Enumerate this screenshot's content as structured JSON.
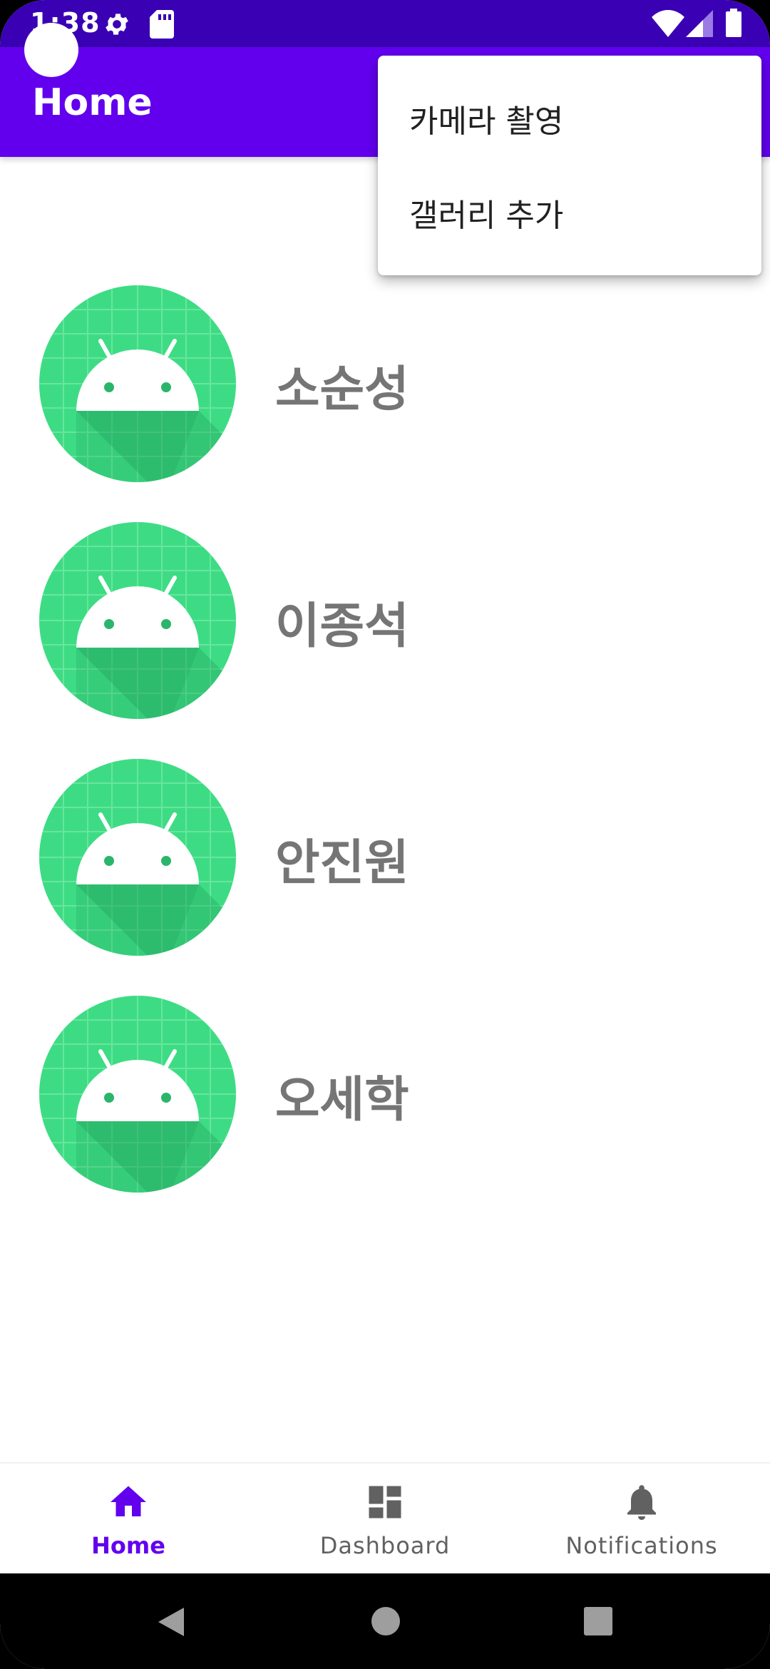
{
  "status_bar": {
    "time": "1:38",
    "icons": [
      "gear-icon",
      "sd-card-icon",
      "wifi-icon",
      "signal-icon",
      "battery-icon"
    ]
  },
  "app_bar": {
    "title": "Home",
    "color": "#6200ee"
  },
  "menu": {
    "items": [
      {
        "label": "카메라 촬영"
      },
      {
        "label": "갤러리 추가"
      }
    ]
  },
  "contacts": [
    {
      "name": "소순성",
      "icon": "android-avatar-icon"
    },
    {
      "name": "이종석",
      "icon": "android-avatar-icon"
    },
    {
      "name": "안진원",
      "icon": "android-avatar-icon"
    },
    {
      "name": "오세학",
      "icon": "android-avatar-icon"
    }
  ],
  "bottom_nav": {
    "items": [
      {
        "label": "Home",
        "icon": "home-icon",
        "selected": true
      },
      {
        "label": "Dashboard",
        "icon": "dashboard-icon",
        "selected": false
      },
      {
        "label": "Notifications",
        "icon": "bell-icon",
        "selected": false
      }
    ],
    "active_color": "#6200ee",
    "inactive_color": "#616161"
  },
  "system_nav": {
    "icons": [
      "back-icon",
      "home-circle-icon",
      "recents-icon"
    ]
  }
}
